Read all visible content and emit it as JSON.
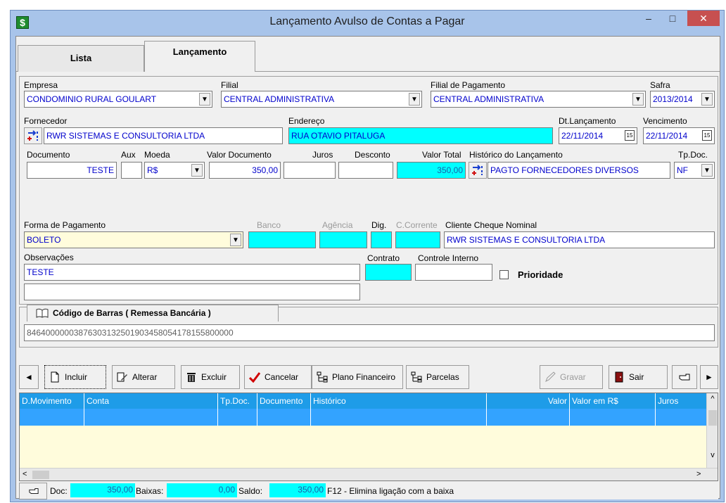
{
  "window": {
    "title": "Lançamento Avulso de Contas a Pagar",
    "app_icon_glyph": "$",
    "minimize_glyph": "–",
    "maximize_glyph": "□",
    "close_glyph": "✕"
  },
  "tabs": [
    {
      "label": "Lista",
      "active": false
    },
    {
      "label": "Lançamento",
      "active": true
    }
  ],
  "form": {
    "empresa": {
      "label": "Empresa",
      "value": "CONDOMINIO RURAL GOULART"
    },
    "filial": {
      "label": "Filial",
      "value": "CENTRAL ADMINISTRATIVA"
    },
    "filial_pagamento": {
      "label": "Filial de Pagamento",
      "value": "CENTRAL ADMINISTRATIVA"
    },
    "safra": {
      "label": "Safra",
      "value": "2013/2014"
    },
    "fornecedor": {
      "label": "Fornecedor",
      "value": "RWR SISTEMAS E CONSULTORIA LTDA"
    },
    "endereco": {
      "label": "Endereço",
      "value": "RUA OTAVIO PITALUGA"
    },
    "dt_lancamento": {
      "label": "Dt.Lançamento",
      "value": "22/11/2014"
    },
    "vencimento": {
      "label": "Vencimento",
      "value": "22/11/2014"
    },
    "calendar_glyph": "15",
    "documento": {
      "label": "Documento",
      "value": "TESTE"
    },
    "aux": {
      "label": "Aux",
      "value": ""
    },
    "moeda": {
      "label": "Moeda",
      "value": "R$"
    },
    "valor_documento": {
      "label": "Valor Documento",
      "value": "350,00"
    },
    "juros": {
      "label": "Juros",
      "value": ""
    },
    "desconto": {
      "label": "Desconto",
      "value": ""
    },
    "valor_total": {
      "label": "Valor Total",
      "value": "350,00"
    },
    "historico": {
      "label": "Histórico do Lançamento",
      "value": "PAGTO FORNECEDORES DIVERSOS"
    },
    "tp_doc": {
      "label": "Tp.Doc.",
      "value": "NF"
    },
    "forma_pagamento": {
      "label": "Forma de Pagamento",
      "value": "BOLETO"
    },
    "banco": {
      "label": "Banco",
      "value": ""
    },
    "agencia": {
      "label": "Agência",
      "value": ""
    },
    "dig": {
      "label": "Dig.",
      "value": ""
    },
    "c_corrente": {
      "label": "C.Corrente",
      "value": ""
    },
    "cliente_cheque": {
      "label": "Cliente Cheque Nominal",
      "value": "RWR SISTEMAS E CONSULTORIA LTDA"
    },
    "observacoes": {
      "label": "Observações",
      "value": "TESTE",
      "value2": ""
    },
    "contrato": {
      "label": "Contrato",
      "value": ""
    },
    "controle_interno": {
      "label": "Controle Interno",
      "value": ""
    },
    "prioridade": {
      "label": "Prioridade",
      "checked": false
    }
  },
  "barcode": {
    "tab_label": "Código de Barras ( Remessa Bancária )",
    "value": "84640000003876303132501903458054178155800000"
  },
  "toolbar": {
    "prev_glyph": "◄",
    "next_glyph": "►",
    "incluir": "Incluir",
    "alterar": "Alterar",
    "excluir": "Excluir",
    "cancelar": "Cancelar",
    "plano_financeiro": "Plano Financeiro",
    "parcelas": "Parcelas",
    "gravar": "Gravar",
    "sair": "Sair"
  },
  "grid": {
    "columns": [
      "D.Movimento",
      "Conta",
      "Tp.Doc.",
      "Documento",
      "Histórico",
      "Valor",
      "Valor em R$",
      "Juros"
    ],
    "scroll_up": "^",
    "scroll_down": "v",
    "scroll_left": "<",
    "scroll_right": ">"
  },
  "footer": {
    "doc_label": "Doc:",
    "doc_value": "350,00",
    "baixas_label": "Baixas:",
    "baixas_value": "0,00",
    "saldo_label": "Saldo:",
    "saldo_value": "350,00",
    "hint": "F12 - Elimina ligação com a baixa"
  },
  "colors": {
    "title_bar": "#a8c4ea",
    "close_button": "#c75050",
    "field_text": "#0000cc",
    "highlight_cyan": "#00ffff",
    "grid_header": "#1e9ce8",
    "grid_selected": "#33a3ff",
    "grid_background": "#fffcdc"
  },
  "icons": [
    "app-icon",
    "fornecedor-picker-icon",
    "historico-picker-icon",
    "book-icon",
    "new-document-icon",
    "edit-icon",
    "trash-icon",
    "checkmark-icon",
    "plan-icon",
    "parcels-icon",
    "save-icon",
    "exit-door-icon",
    "pointing-hand-icon"
  ]
}
